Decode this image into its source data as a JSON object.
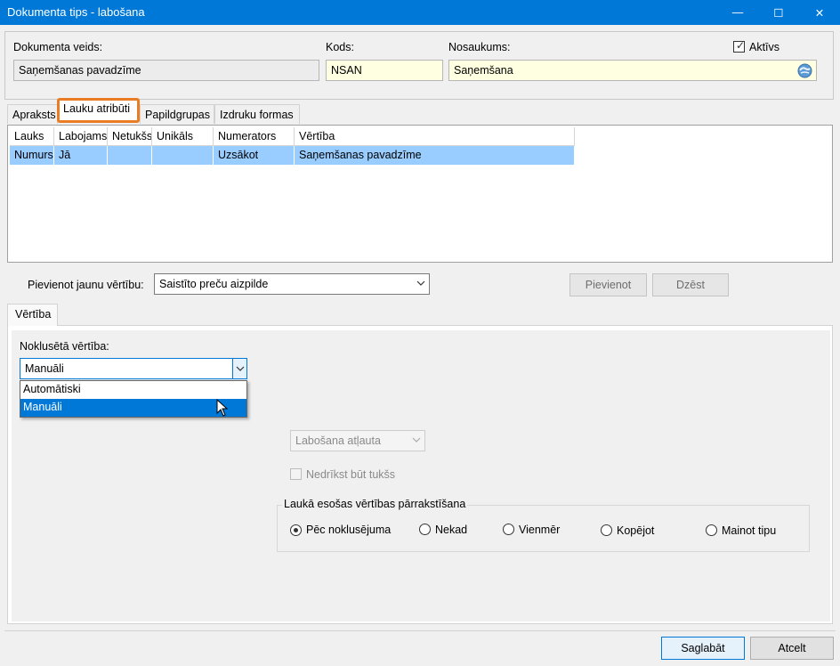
{
  "window": {
    "title": "Dokumenta tips - labošana",
    "minimize_glyph": "—",
    "maximize_glyph": "☐",
    "close_glyph": "✕"
  },
  "header": {
    "doc_type_label": "Dokumenta veids:",
    "doc_type_value": "Saņemšanas pavadzīme",
    "code_label": "Kods:",
    "code_value": "NSAN",
    "name_label": "Nosaukums:",
    "name_value": "Saņemšana",
    "active_label": "Aktīvs",
    "active_checked": true
  },
  "tabs": [
    {
      "label": "Apraksts"
    },
    {
      "label": "Lauku atribūti",
      "active": true
    },
    {
      "label": "Papildgrupas"
    },
    {
      "label": "Izdruku formas"
    }
  ],
  "grid": {
    "columns": [
      "Lauks",
      "Labojams",
      "Netukšs",
      "Unikāls",
      "Numerators",
      "Vērtība"
    ],
    "rows": [
      [
        "Numurs",
        "Jā",
        "",
        "",
        "Uzsākot",
        "Saņemšanas pavadzīme"
      ]
    ]
  },
  "add_value": {
    "label": "Pievienot jaunu vērtību:",
    "selected": "Saistīto preču aizpilde",
    "add_button": "Pievienot",
    "delete_button": "Dzēst"
  },
  "value_tab": {
    "label": "Vērtība"
  },
  "default_value": {
    "label": "Noklusētā vērtība:",
    "selected": "Manuāli",
    "options": [
      "Automātiski",
      "Manuāli"
    ],
    "highlighted_index": 1
  },
  "edit_combo": {
    "value": "Labošana atļauta"
  },
  "not_empty": {
    "label": "Nedrīkst būt tukšs"
  },
  "overwrite_group": {
    "title": "Laukā esošas vērtības pārrakstīšana",
    "options": [
      "Pēc noklusējuma",
      "Nekad",
      "Vienmēr",
      "Kopējot",
      "Mainot tipu"
    ],
    "selected_index": 0
  },
  "footer": {
    "save_button": "Saglabāt",
    "cancel_button": "Atcelt"
  },
  "colors": {
    "titlebar": "#0078d7",
    "selection": "#99ccff",
    "tab_highlight": "#ea7d24",
    "required_field": "#ffffe1"
  }
}
